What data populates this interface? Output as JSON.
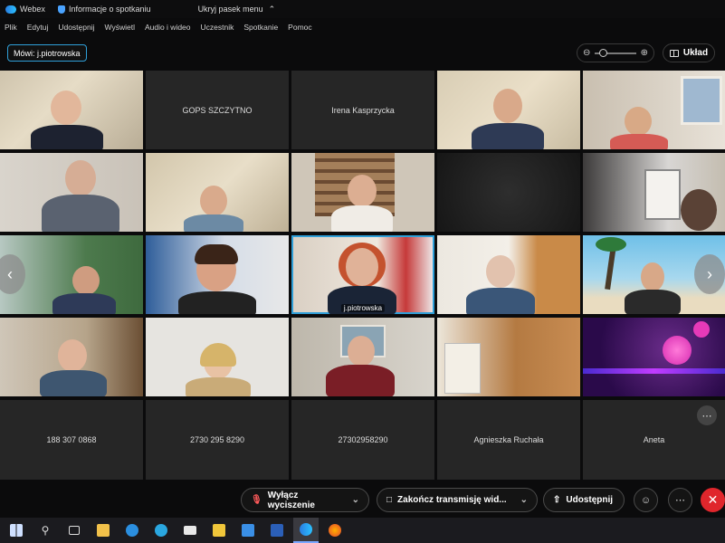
{
  "titlebar": {
    "app_name": "Webex",
    "meeting_info": "Informacje o spotkaniu",
    "hide_menu": "Ukryj pasek menu"
  },
  "menu": [
    "Plik",
    "Edytuj",
    "Udostępnij",
    "Wyświetl",
    "Audio i wideo",
    "Uczestnik",
    "Spotkanie",
    "Pomoc"
  ],
  "speaker": {
    "label": "Mówi: j.piotrowska"
  },
  "toolbar": {
    "layout_label": "Układ",
    "zoom_level": 0.2
  },
  "tiles": {
    "t_gops": "GOPS SZCZYTNO",
    "t_irena": "Irena Kasprzycka",
    "t_jp": "j.piotrowska",
    "t_188": "188 307 0868",
    "t_2730a": "2730 295 8290",
    "t_2730b": "27302958290",
    "t_agn": "Agnieszka Ruchała",
    "t_aneta": "Aneta"
  },
  "controls": {
    "mute_label": "Wyłącz wyciszenie",
    "video_label": "Zakończ transmisję wid...",
    "share_label": "Udostępnij"
  },
  "icons": [
    "webex-logo-icon",
    "shield-icon",
    "chevron-up-icon",
    "zoom-out-icon",
    "zoom-in-icon",
    "layout-grid-icon",
    "mic-muted-icon",
    "camera-icon",
    "share-icon",
    "reactions-icon",
    "more-icon",
    "end-call-icon",
    "chevron-left-icon",
    "chevron-right-icon"
  ],
  "colors": {
    "accent": "#2f9fd8",
    "end_call": "#e0262c",
    "tile_bg": "#262626"
  }
}
